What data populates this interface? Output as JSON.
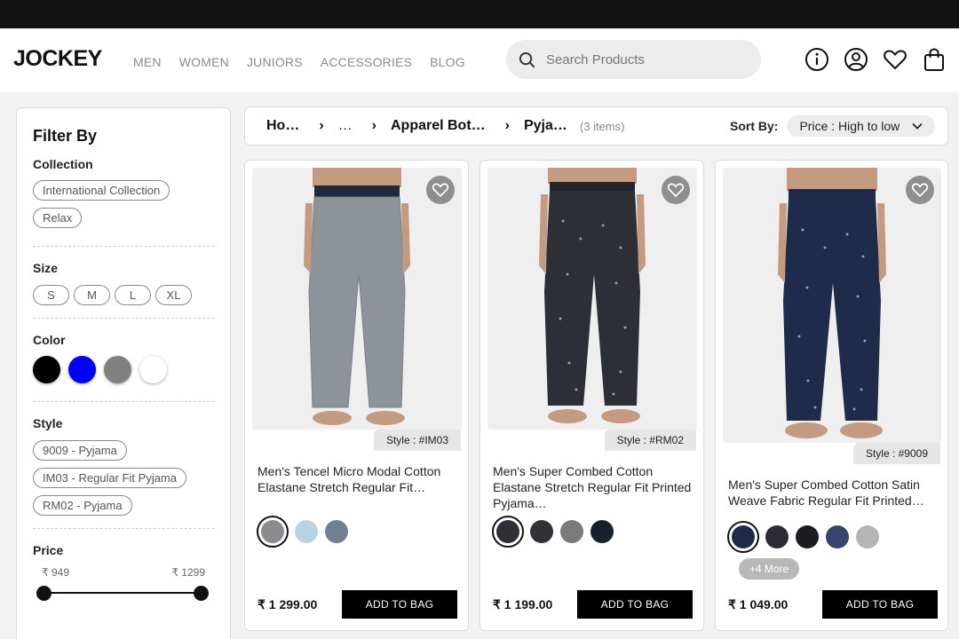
{
  "header": {
    "logo": "JOCKEY",
    "nav": [
      "MEN",
      "WOMEN",
      "JUNIORS",
      "ACCESSORIES",
      "BLOG"
    ],
    "search_placeholder": "Search Products",
    "icons": [
      "info-icon",
      "user-icon",
      "heart-icon",
      "bag-icon"
    ]
  },
  "sidebar": {
    "title": "Filter By",
    "collection": {
      "title": "Collection",
      "options": [
        "International Collection",
        "Relax"
      ]
    },
    "size": {
      "title": "Size",
      "options": [
        "S",
        "M",
        "L",
        "XL"
      ]
    },
    "color": {
      "title": "Color",
      "swatches": [
        "#000000",
        "#0000ff",
        "#808080",
        "#ffffff"
      ]
    },
    "style": {
      "title": "Style",
      "options": [
        "9009 - Pyjama",
        "IM03 - Regular Fit Pyjama",
        "RM02 - Pyjama"
      ]
    },
    "price": {
      "title": "Price",
      "min": "₹ 949",
      "max": "₹ 1299"
    }
  },
  "breadcrumb": {
    "items": [
      "Ho…",
      "…",
      "Apparel Bot…",
      "Pyja…"
    ],
    "count": "(3 items)"
  },
  "sort": {
    "label": "Sort By:",
    "value": "Price : High to low"
  },
  "products": [
    {
      "style": "Style : #IM03",
      "name": "Men's Tencel Micro Modal Cotton Elastane Stretch Regular Fit…",
      "swatches": [
        "#8a8d90",
        "#b9d3e6",
        "#6f7f94"
      ],
      "price": "₹ 1 299.00",
      "button": "ADD TO BAG"
    },
    {
      "style": "Style : #RM02",
      "name": "Men's Super Combed Cotton Elastane Stretch Regular Fit Printed Pyjama…",
      "swatches": [
        "#2e3036",
        "#303236",
        "#7a7a7a",
        "#1a1f2e"
      ],
      "price": "₹ 1 199.00",
      "button": "ADD TO BAG"
    },
    {
      "style": "Style : #9009",
      "name": "Men's Super Combed Cotton Satin Weave Fabric Regular Fit Printed…",
      "swatches": [
        "#1e2a48",
        "#2a2d33",
        "#1c1d20",
        "#35456e",
        "#b5b5b5"
      ],
      "more": "+4 More",
      "price": "₹ 1 049.00",
      "button": "ADD TO BAG"
    }
  ]
}
